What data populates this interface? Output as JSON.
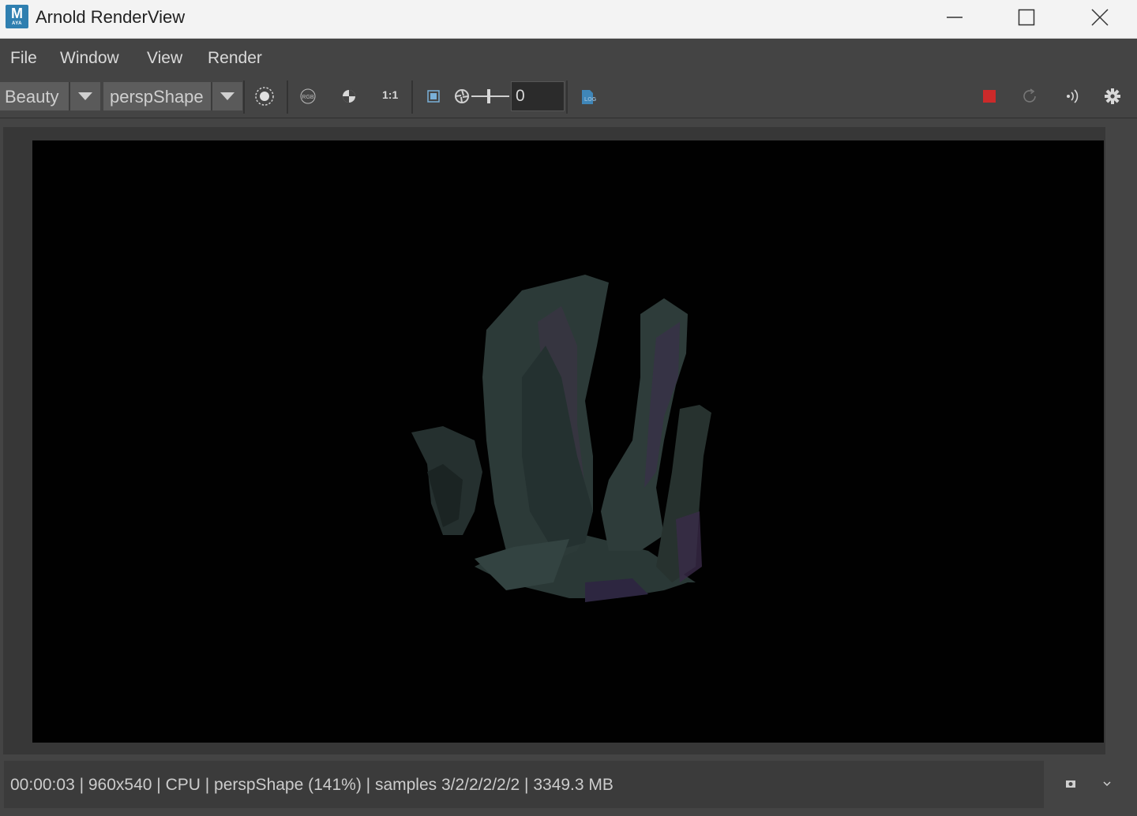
{
  "window": {
    "title": "Arnold RenderView",
    "logo_letter": "M",
    "logo_sub": "AYA"
  },
  "menu": {
    "items": [
      {
        "label": "File"
      },
      {
        "label": "Window"
      },
      {
        "label": "View"
      },
      {
        "label": "Render"
      }
    ]
  },
  "toolbar": {
    "aov_select": "Beauty",
    "camera_select": "perspShape",
    "one_to_one_label": "1:1",
    "exposure_value": "0",
    "rgb_label": "RGB",
    "log_label": "LOG",
    "stop_color": "#cc2a2a",
    "icons": [
      "region-icon",
      "rgb-channels-icon",
      "color-correct-icon",
      "one-to-one-icon",
      "crop-region-icon",
      "exposure-icon",
      "log-icon",
      "stop-render-icon",
      "refresh-icon",
      "ipr-icon",
      "settings-icon"
    ]
  },
  "statusbar": {
    "text": "00:00:03 | 960x540 | CPU | perspShape (141%) | samples 3/2/2/2/2/2 | 3349.3 MB"
  },
  "colors": {
    "background": "#444444",
    "render_background": "#010101",
    "crystal_tint": "#2e3f3d",
    "crystal_accent": "#3a2a48"
  }
}
